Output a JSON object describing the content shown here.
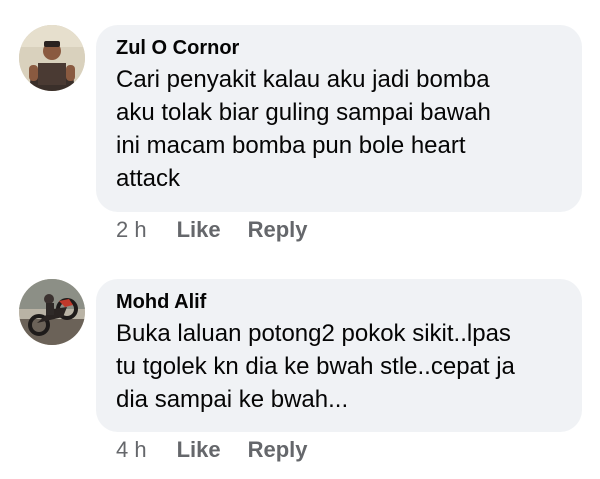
{
  "comments": [
    {
      "author": "Zul O Cornor",
      "lines": [
        "Cari penyakit kalau aku jadi bomba",
        "aku tolak biar guling sampai bawah",
        "ini macam bomba pun bole heart",
        "attack"
      ],
      "time": "2 h",
      "like_label": "Like",
      "reply_label": "Reply"
    },
    {
      "author": "Mohd Alif",
      "lines": [
        "Buka laluan potong2 pokok sikit..lpas",
        "tu tgolek kn dia ke bwah stle..cepat ja",
        "dia sampai ke bwah..."
      ],
      "time": "4 h",
      "like_label": "Like",
      "reply_label": "Reply"
    }
  ],
  "colors": {
    "bubble_bg": "#f0f2f5",
    "text": "#050505",
    "secondary_text": "#65676b"
  }
}
